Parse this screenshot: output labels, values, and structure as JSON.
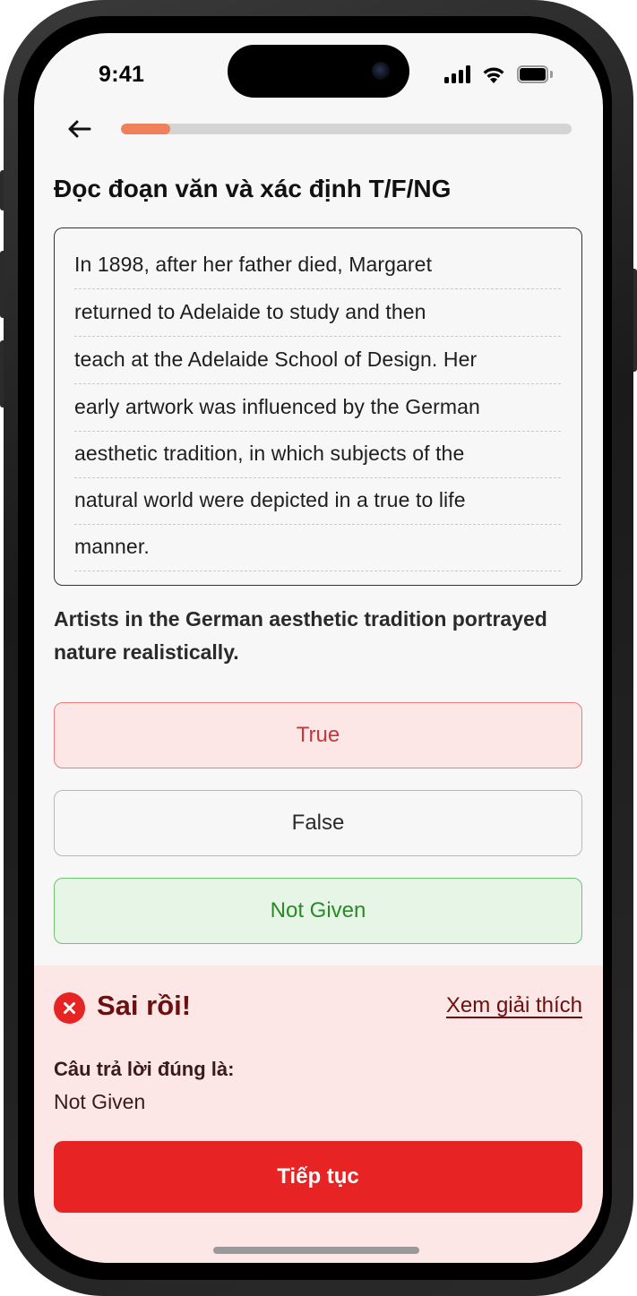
{
  "status_bar": {
    "time": "9:41",
    "icons": [
      "cellular-signal-icon",
      "wifi-icon",
      "battery-icon"
    ]
  },
  "header": {
    "back_icon": "arrow-left-icon",
    "progress": 0.11
  },
  "question": {
    "title": "Đọc đoạn văn và xác định T/F/NG",
    "passage_lines": [
      "In 1898, after her father died, Margaret",
      "returned to Adelaide to study and then",
      "teach at the Adelaide School of Design. Her",
      "early artwork was influenced by the German",
      "aesthetic tradition, in which subjects of the",
      "natural world were depicted in a true to life",
      "manner."
    ],
    "statement": "Artists in the German aesthetic tradition portrayed nature realistically."
  },
  "options": [
    {
      "label": "True",
      "state": "wrong-selected"
    },
    {
      "label": "False",
      "state": "neutral"
    },
    {
      "label": "Not Given",
      "state": "correct"
    }
  ],
  "feedback": {
    "icon": "x-circle-icon",
    "title": "Sai rồi!",
    "explain_link": "Xem giải thích",
    "answer_label": "Câu trả lời đúng là:",
    "answer_value": "Not Given",
    "continue_label": "Tiếp tục"
  },
  "colors": {
    "accent_progress": "#f07f5b",
    "wrong": "#e82323",
    "wrong_bg": "#fde6e6",
    "correct": "#2a8a2a",
    "correct_bg": "#e6f5e6"
  }
}
